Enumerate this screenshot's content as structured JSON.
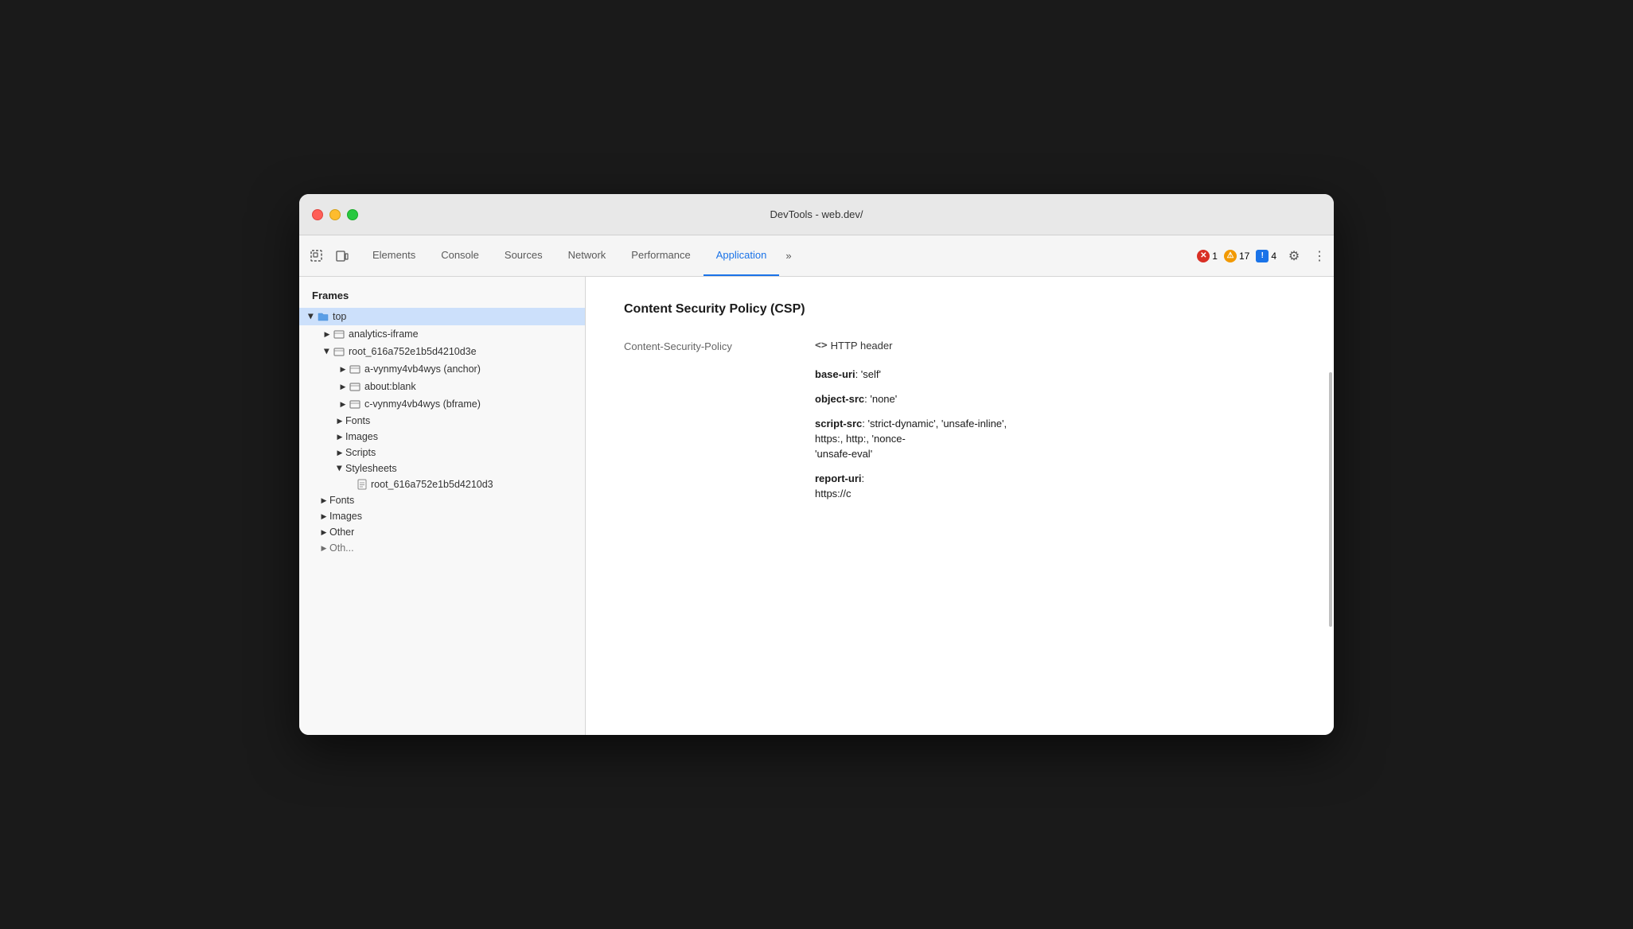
{
  "window": {
    "title": "DevTools - web.dev/"
  },
  "toolbar": {
    "icons": [
      {
        "name": "element-picker-icon",
        "symbol": "⊹"
      },
      {
        "name": "device-toggle-icon",
        "symbol": "▭"
      }
    ],
    "tabs": [
      {
        "id": "elements",
        "label": "Elements",
        "active": false
      },
      {
        "id": "console",
        "label": "Console",
        "active": false
      },
      {
        "id": "sources",
        "label": "Sources",
        "active": false
      },
      {
        "id": "network",
        "label": "Network",
        "active": false
      },
      {
        "id": "performance",
        "label": "Performance",
        "active": false
      },
      {
        "id": "application",
        "label": "Application",
        "active": true
      }
    ],
    "more_tabs_icon": "»",
    "badges": [
      {
        "type": "error",
        "icon": "✕",
        "count": "1"
      },
      {
        "type": "warning",
        "icon": "⚠",
        "count": "17"
      },
      {
        "type": "info",
        "icon": "!",
        "count": "4"
      }
    ],
    "gear_icon": "⚙",
    "more_icon": "⋮"
  },
  "sidebar": {
    "header": "Frames",
    "items": [
      {
        "id": "top",
        "label": "top",
        "level": 0,
        "type": "folder",
        "expanded": true,
        "selected": false,
        "has_arrow": true,
        "arrow_expanded": true
      },
      {
        "id": "analytics-iframe",
        "label": "analytics-iframe",
        "level": 1,
        "type": "folder",
        "expanded": false,
        "selected": false,
        "has_arrow": true,
        "arrow_expanded": false
      },
      {
        "id": "root-frame",
        "label": "root_616a752e1b5d4210d3e",
        "level": 1,
        "type": "folder",
        "expanded": true,
        "selected": false,
        "has_arrow": true,
        "arrow_expanded": true
      },
      {
        "id": "a-anchor",
        "label": "a-vynmy4vb4wys (anchor)",
        "level": 2,
        "type": "folder",
        "expanded": false,
        "selected": false,
        "has_arrow": true,
        "arrow_expanded": false
      },
      {
        "id": "about-blank",
        "label": "about:blank",
        "level": 2,
        "type": "folder",
        "expanded": false,
        "selected": false,
        "has_arrow": true,
        "arrow_expanded": false
      },
      {
        "id": "c-bframe",
        "label": "c-vynmy4vb4wys (bframe)",
        "level": 2,
        "type": "folder",
        "expanded": false,
        "selected": false,
        "has_arrow": true,
        "arrow_expanded": false
      },
      {
        "id": "fonts-root",
        "label": "Fonts",
        "level": 2,
        "type": "folder-group",
        "expanded": false,
        "selected": false,
        "has_arrow": true,
        "arrow_expanded": false
      },
      {
        "id": "images-root",
        "label": "Images",
        "level": 2,
        "type": "folder-group",
        "expanded": false,
        "selected": false,
        "has_arrow": true,
        "arrow_expanded": false
      },
      {
        "id": "scripts-root",
        "label": "Scripts",
        "level": 2,
        "type": "folder-group",
        "expanded": false,
        "selected": false,
        "has_arrow": true,
        "arrow_expanded": false
      },
      {
        "id": "stylesheets-root",
        "label": "Stylesheets",
        "level": 2,
        "type": "folder-group",
        "expanded": true,
        "selected": false,
        "has_arrow": true,
        "arrow_expanded": true
      },
      {
        "id": "stylesheet-file",
        "label": "root_616a752e1b5d4210d3",
        "level": 3,
        "type": "file",
        "expanded": false,
        "selected": false,
        "has_arrow": false
      },
      {
        "id": "fonts-top",
        "label": "Fonts",
        "level": 1,
        "type": "folder-group",
        "expanded": false,
        "selected": false,
        "has_arrow": true,
        "arrow_expanded": false
      },
      {
        "id": "images-top",
        "label": "Images",
        "level": 1,
        "type": "folder-group",
        "expanded": false,
        "selected": false,
        "has_arrow": true,
        "arrow_expanded": false
      },
      {
        "id": "other-top",
        "label": "Other",
        "level": 1,
        "type": "folder-group",
        "expanded": false,
        "selected": false,
        "has_arrow": true,
        "arrow_expanded": false
      },
      {
        "id": "other-2",
        "label": "Oth...",
        "level": 1,
        "type": "folder-group",
        "expanded": false,
        "selected": false,
        "has_arrow": true,
        "arrow_expanded": false
      }
    ]
  },
  "content": {
    "title": "Content Security Policy (CSP)",
    "rows": [
      {
        "key": "Content-Security-Policy",
        "value_type": "http-header",
        "value": "<> HTTP header"
      },
      {
        "key": "",
        "value_type": "directive",
        "directive": "base-uri",
        "value": ": 'self'"
      },
      {
        "key": "",
        "value_type": "directive",
        "directive": "object-src",
        "value": ": 'none'"
      },
      {
        "key": "",
        "value_type": "directive",
        "directive": "script-src",
        "value": ": 'strict-dynamic', 'unsafe-inline',"
      },
      {
        "key": "",
        "value_type": "text",
        "value": "https:, http:, 'nonce-"
      },
      {
        "key": "",
        "value_type": "text",
        "value": "'unsafe-eval'"
      },
      {
        "key": "",
        "value_type": "directive",
        "directive": "report-uri",
        "value": ":"
      },
      {
        "key": "",
        "value_type": "text",
        "value": "https://c"
      }
    ]
  }
}
